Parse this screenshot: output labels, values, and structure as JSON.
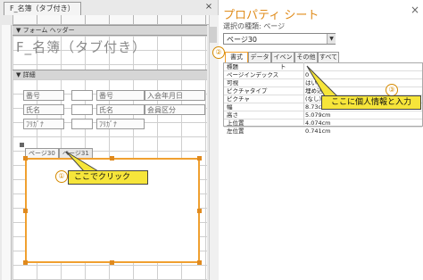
{
  "design": {
    "doc_tab_title": "F_名簿（タブ付き）",
    "close_glyph": "×",
    "form_header_label": "フォーム ヘッダー",
    "form_title": "F_名簿（タブ付き）",
    "detail_label": "詳細",
    "fields": {
      "label_bango1": "番号",
      "label_bango2": "番号",
      "label_nyukai": "入会年月日",
      "label_shimei1": "氏名",
      "label_shimei2": "氏名",
      "label_kaiin": "会員区分",
      "label_furigana1": "ﾌﾘｶﾞﾅ",
      "label_furigana2": "ﾌﾘｶﾞﾅ"
    },
    "tabs": [
      {
        "label": "ページ30"
      },
      {
        "label": "ページ31"
      }
    ],
    "callout_1": {
      "number": "①",
      "text": "ここでクリック"
    }
  },
  "property_sheet": {
    "title": "プロパティ シート",
    "selection_type": "選択の種類: ページ",
    "selected_object": "ページ30",
    "close_glyph": "×",
    "callout_2_number": "②",
    "tabs": [
      "書式",
      "データ",
      "イベント",
      "その他",
      "すべて"
    ],
    "properties": [
      {
        "name": "標題",
        "value": ""
      },
      {
        "name": "ページインデックス",
        "value": "0"
      },
      {
        "name": "可視",
        "value": "はい"
      },
      {
        "name": "ピクチャタイプ",
        "value": "埋め込み"
      },
      {
        "name": "ピクチャ",
        "value": "(なし)"
      },
      {
        "name": "幅",
        "value": "8.73cm"
      },
      {
        "name": "高さ",
        "value": "5.079cm"
      },
      {
        "name": "上位置",
        "value": "4.074cm"
      },
      {
        "name": "左位置",
        "value": "0.741cm"
      }
    ],
    "callout_3": {
      "number": "③",
      "text": "ここに個人情報と入力"
    }
  },
  "colors": {
    "accent": "#e08c1b",
    "callout_bg": "#f6e53a",
    "selection_border": "#f0a030"
  }
}
